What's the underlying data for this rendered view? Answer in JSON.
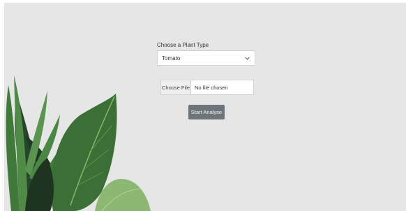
{
  "form": {
    "plant_label": "Choose a Plant Type",
    "plant_select_value": "Tomato",
    "choose_file_label": "Choose File",
    "file_status": "No file chosen",
    "submit_label": "Start Analyse"
  },
  "colors": {
    "background": "#e6e6e6",
    "button": "#6e747a",
    "leaf_dark": "#2f5a2c",
    "leaf_light": "#86b067"
  },
  "icons": {
    "select_caret": "chevron-down-icon",
    "decoration": "plant-leaves-illustration"
  }
}
